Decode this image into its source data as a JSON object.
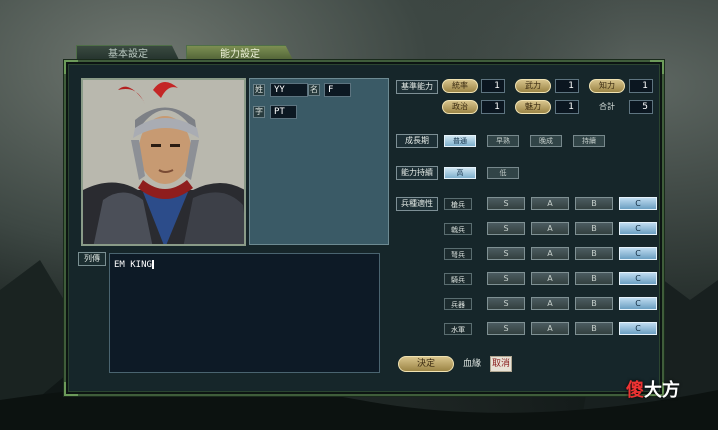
{
  "tabs": [
    {
      "label": "基本設定"
    },
    {
      "label": "能力設定"
    }
  ],
  "name_fields": {
    "surname_label": "姓",
    "surname_value": "YY",
    "given_label": "名",
    "given_value": "F",
    "style_label": "字",
    "style_value": "PT"
  },
  "bio": {
    "label": "列傳",
    "text": "EM KING"
  },
  "abilities": {
    "header": "基準能力",
    "stats": [
      {
        "label": "統率",
        "value": "1"
      },
      {
        "label": "武力",
        "value": "1"
      },
      {
        "label": "知力",
        "value": "1"
      },
      {
        "label": "政治",
        "value": "1"
      },
      {
        "label": "魅力",
        "value": "1"
      },
      {
        "label": "合計",
        "value": "5"
      }
    ]
  },
  "growth": {
    "header": "成長期",
    "options": [
      "普通",
      "早熟",
      "晚成",
      "持續"
    ],
    "selected": 0
  },
  "maintain": {
    "header": "能力持續",
    "options": [
      "高",
      "低"
    ],
    "selected": 0
  },
  "aptitude": {
    "header": "兵種適性",
    "grades": [
      "S",
      "A",
      "B",
      "C"
    ],
    "selected_grade": "C",
    "units": [
      "槍兵",
      "戟兵",
      "弩兵",
      "騎兵",
      "兵器",
      "水軍"
    ]
  },
  "footer": {
    "confirm_label": "決定",
    "blood_label": "血緣",
    "reset_label": "取消"
  },
  "watermark": {
    "char1": "傻",
    "rest": "大方"
  }
}
